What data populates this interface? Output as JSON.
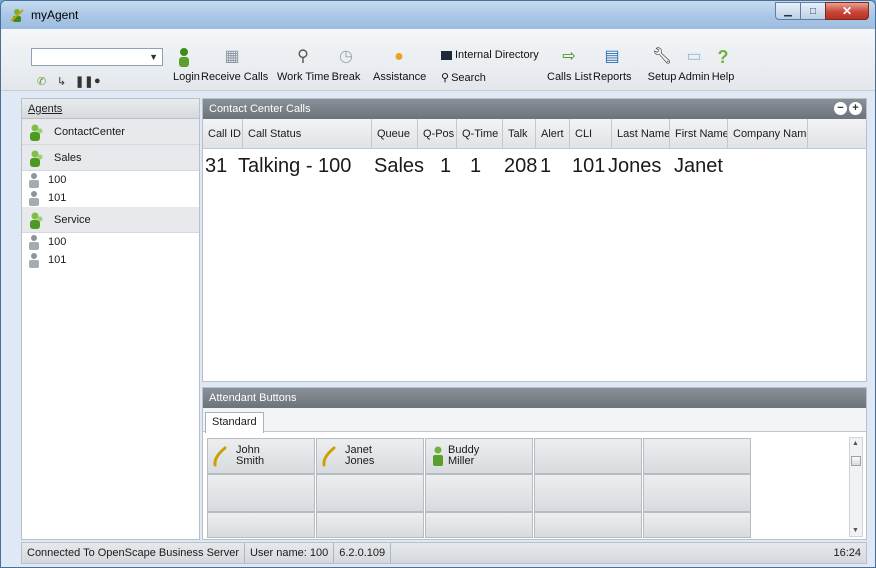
{
  "window": {
    "title": "myAgent"
  },
  "toolbar": {
    "login": "Login",
    "receive_calls": "Receive Calls",
    "work_time": "Work Time",
    "break": "Break",
    "assistance": "Assistance",
    "internal_directory": "Internal Directory",
    "search": "Search",
    "calls_list": "Calls List",
    "reports": "Reports",
    "setup": "Setup",
    "admin": "Admin",
    "help": "Help"
  },
  "agents": {
    "header": "Agents",
    "groups": [
      {
        "name": "ContactCenter",
        "agents": []
      },
      {
        "name": "Sales",
        "agents": [
          "100",
          "101"
        ]
      },
      {
        "name": "Service",
        "agents": [
          "100",
          "101"
        ]
      }
    ]
  },
  "calls": {
    "title": "Contact Center Calls",
    "columns": [
      "Call ID",
      "Call Status",
      "Queue",
      "Q-Pos",
      "Q-Time",
      "Talk",
      "Alert",
      "CLI",
      "Last Name",
      "First Name",
      "Company Name"
    ],
    "rows": [
      {
        "call_id": "31",
        "call_status": "Talking - 100",
        "queue": "Sales",
        "q_pos": "1",
        "q_time": "1",
        "talk": "208",
        "alert": "1",
        "cli": "101",
        "last_name": "Jones",
        "first_name": "Janet",
        "company": ""
      }
    ]
  },
  "attendant": {
    "title": "Attendant Buttons",
    "tab": "Standard",
    "buttons": [
      {
        "first": "John",
        "last": "Smith",
        "icon": "phone-handset-icon"
      },
      {
        "first": "Janet",
        "last": "Jones",
        "icon": "phone-handset-icon"
      },
      {
        "first": "Buddy",
        "last": "Miller",
        "icon": "person-icon"
      }
    ]
  },
  "status": {
    "connection": "Connected To OpenScape Business Server",
    "user": "User name: 100",
    "version": "6.2.0.109",
    "time": "16:24"
  },
  "colors": {
    "accent_green": "#5aa02c",
    "header_gray": "#777d84",
    "title_blue": "#a9c6e5"
  }
}
